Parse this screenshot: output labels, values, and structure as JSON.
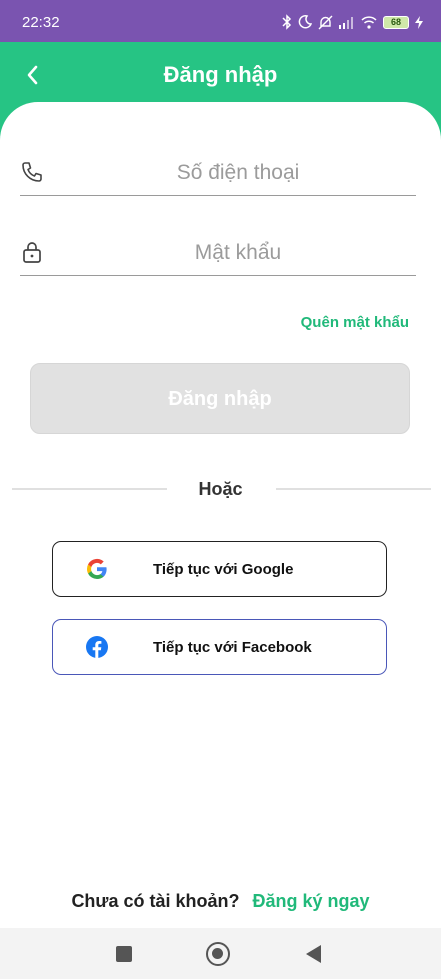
{
  "status_bar": {
    "time": "22:32",
    "battery": "68",
    "icons": [
      "bluetooth-icon",
      "moon-icon",
      "mute-icon",
      "signal-icon",
      "wifi-icon",
      "battery-icon",
      "charging-icon"
    ]
  },
  "header": {
    "title": "Đăng nhập",
    "back_icon": "chevron-left-icon"
  },
  "form": {
    "phone_placeholder": "Số điện thoại",
    "phone_value": "",
    "password_placeholder": "Mật khẩu",
    "password_value": "",
    "forgot_password": "Quên mật khẩu",
    "login_button": "Đăng nhập"
  },
  "divider": "Hoặc",
  "social": {
    "google_label": "Tiếp tục với Google",
    "facebook_label": "Tiếp tục với Facebook"
  },
  "signup": {
    "prompt": "Chưa có tài khoản?",
    "link": "Đăng ký ngay"
  },
  "colors": {
    "status_bar": "#7a54b0",
    "brand_green": "#26c484",
    "link_green": "#21b97a",
    "disabled_button": "#e1e1e1",
    "facebook_border": "#4a57b8"
  }
}
